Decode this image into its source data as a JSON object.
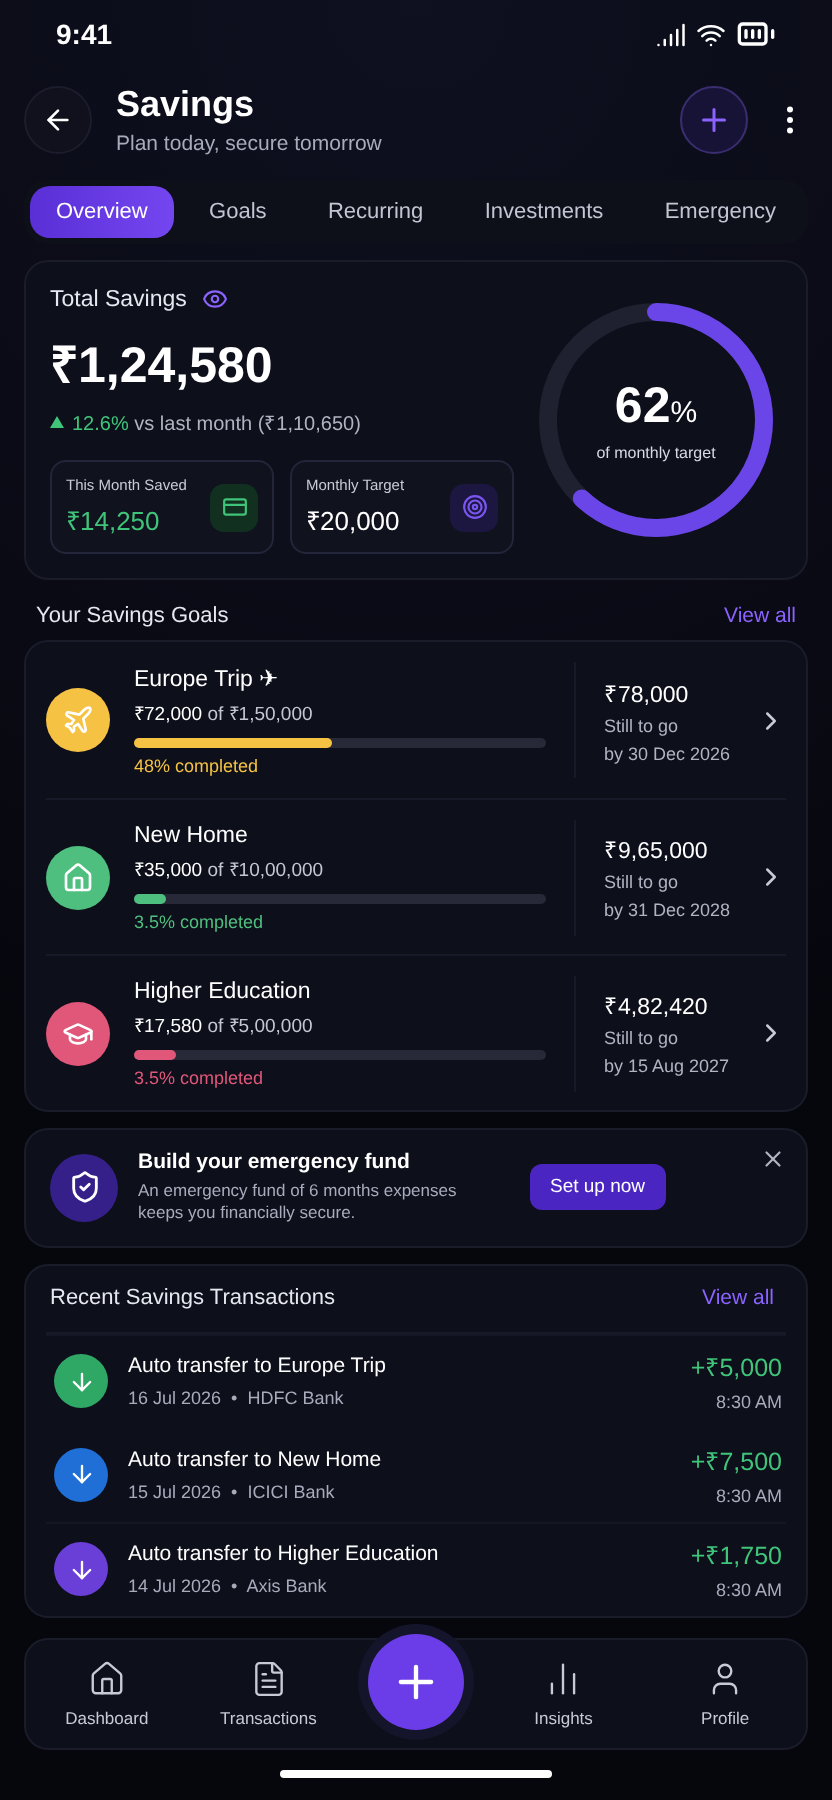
{
  "status_bar": {
    "time": "9:41"
  },
  "header": {
    "title": "Savings",
    "subtitle": "Plan today, secure tomorrow"
  },
  "tabs": [
    {
      "label": "Overview",
      "selected": true
    },
    {
      "label": "Goals",
      "selected": false
    },
    {
      "label": "Recurring",
      "selected": false
    },
    {
      "label": "Investments",
      "selected": false
    },
    {
      "label": "Emergency",
      "selected": false
    }
  ],
  "summary": {
    "title": "Total Savings",
    "amount": "₹1,24,580",
    "change": "12.6%",
    "change_text": "vs last month (₹1,10,650)",
    "stats": [
      {
        "label": "This Month Saved",
        "value": "₹14,250",
        "kind": "wallet"
      },
      {
        "label": "Monthly Target",
        "value": "₹20,000",
        "kind": "target"
      }
    ],
    "target": {
      "percent": "62",
      "unit": "%",
      "caption": "of monthly target",
      "level": 0.62
    }
  },
  "goals": {
    "title": "Your Savings Goals",
    "link": "View all",
    "items": [
      {
        "name": "Europe Trip ✈",
        "kind": "plane",
        "color": "#f5c244",
        "progress": "₹72,000",
        "of": "of",
        "total": "₹1,50,000",
        "level": 0.48,
        "completed": "48% completed",
        "remaining": "₹78,000",
        "remaining_label": "Still to go",
        "due": "by 30 Dec 2026"
      },
      {
        "name": "New Home",
        "kind": "home",
        "color": "#4fbf7f",
        "progress": "₹35,000",
        "of": "of",
        "total": "₹10,00,000",
        "level": 0.08,
        "completed": "3.5% completed",
        "remaining": "₹9,65,000",
        "remaining_label": "Still to go",
        "due": "by 31 Dec 2028"
      },
      {
        "name": "Higher Education",
        "kind": "education",
        "color": "#e0577a",
        "progress": "₹17,580",
        "of": "of",
        "total": "₹5,00,000",
        "level": 0.1,
        "completed": "3.5% completed",
        "remaining": "₹4,82,420",
        "remaining_label": "Still to go",
        "due": "by 15 Aug 2027"
      }
    ]
  },
  "banner": {
    "title": "Build your emergency fund",
    "text": "An emergency fund of 6 months expenses keeps you financially secure.",
    "button": "Set up now"
  },
  "transactions": {
    "title": "Recent Savings Transactions",
    "link": "View all",
    "items": [
      {
        "title": "Auto transfer to Europe Trip",
        "details": "16 Jul 2026  •  HDFC Bank",
        "amount": "+₹5,000",
        "time": "8:30 AM",
        "color": "#2fa866"
      },
      {
        "title": "Auto transfer to New Home",
        "details": "15 Jul 2026  •  ICICI Bank",
        "amount": "+₹7,500",
        "time": "8:30 AM",
        "color": "#1f6fd6"
      },
      {
        "title": "Auto transfer to Higher Education",
        "details": "14 Jul 2026  •  Axis Bank",
        "amount": "+₹1,750",
        "time": "8:30 AM",
        "color": "#6a3fd8"
      }
    ]
  },
  "nav": [
    {
      "label": "Dashboard",
      "kind": "home"
    },
    {
      "label": "Transactions",
      "kind": "list"
    },
    {
      "label": "Insights",
      "kind": "chart"
    },
    {
      "label": "Profile",
      "kind": "user"
    }
  ]
}
